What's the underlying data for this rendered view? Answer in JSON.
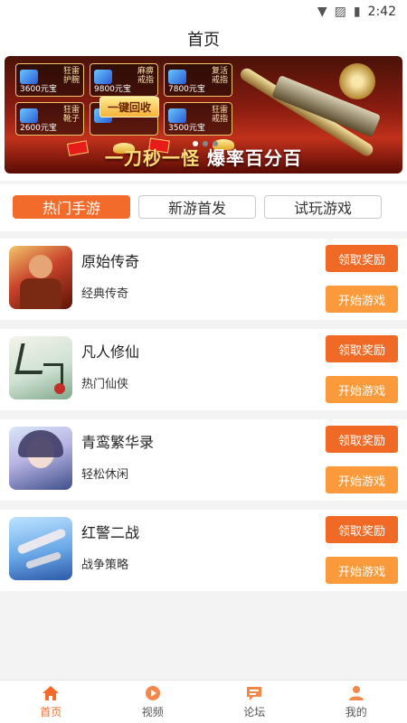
{
  "status": {
    "time": "2:42"
  },
  "header": {
    "title": "首页"
  },
  "banner": {
    "items": [
      {
        "name1": "狂雷",
        "name2": "护腕",
        "price": "3600元宝"
      },
      {
        "name1": "麻痹",
        "name2": "戒指",
        "price": "9800元宝"
      },
      {
        "name1": "复活",
        "name2": "戒指",
        "price": "7800元宝"
      },
      {
        "name1": "狂雷",
        "name2": "靴子",
        "price": "2600元宝"
      },
      {
        "name1": "",
        "name2": "",
        "price": ""
      },
      {
        "name1": "狂雷",
        "name2": "戒指",
        "price": "3500元宝"
      }
    ],
    "recycle_label": "一键回收",
    "slogan_a": "一刀秒一怪",
    "slogan_b": "爆率百分百"
  },
  "tabs": [
    {
      "label": "热门手游"
    },
    {
      "label": "新游首发"
    },
    {
      "label": "试玩游戏"
    }
  ],
  "games": [
    {
      "title": "原始传奇",
      "tag": "经典传奇",
      "claim": "领取奖励",
      "play": "开始游戏"
    },
    {
      "title": "凡人修仙",
      "tag": "热门仙侠",
      "claim": "领取奖励",
      "play": "开始游戏"
    },
    {
      "title": "青鸾繁华录",
      "tag": "轻松休闲",
      "claim": "领取奖励",
      "play": "开始游戏"
    },
    {
      "title": "红警二战",
      "tag": "战争策略",
      "claim": "领取奖励",
      "play": "开始游戏"
    }
  ],
  "tabbar": [
    {
      "label": "首页"
    },
    {
      "label": "视频"
    },
    {
      "label": "论坛"
    },
    {
      "label": "我的"
    }
  ],
  "colors": {
    "accent": "#f26b2b",
    "claim": "#f16a25",
    "play": "#fb9a3a"
  }
}
